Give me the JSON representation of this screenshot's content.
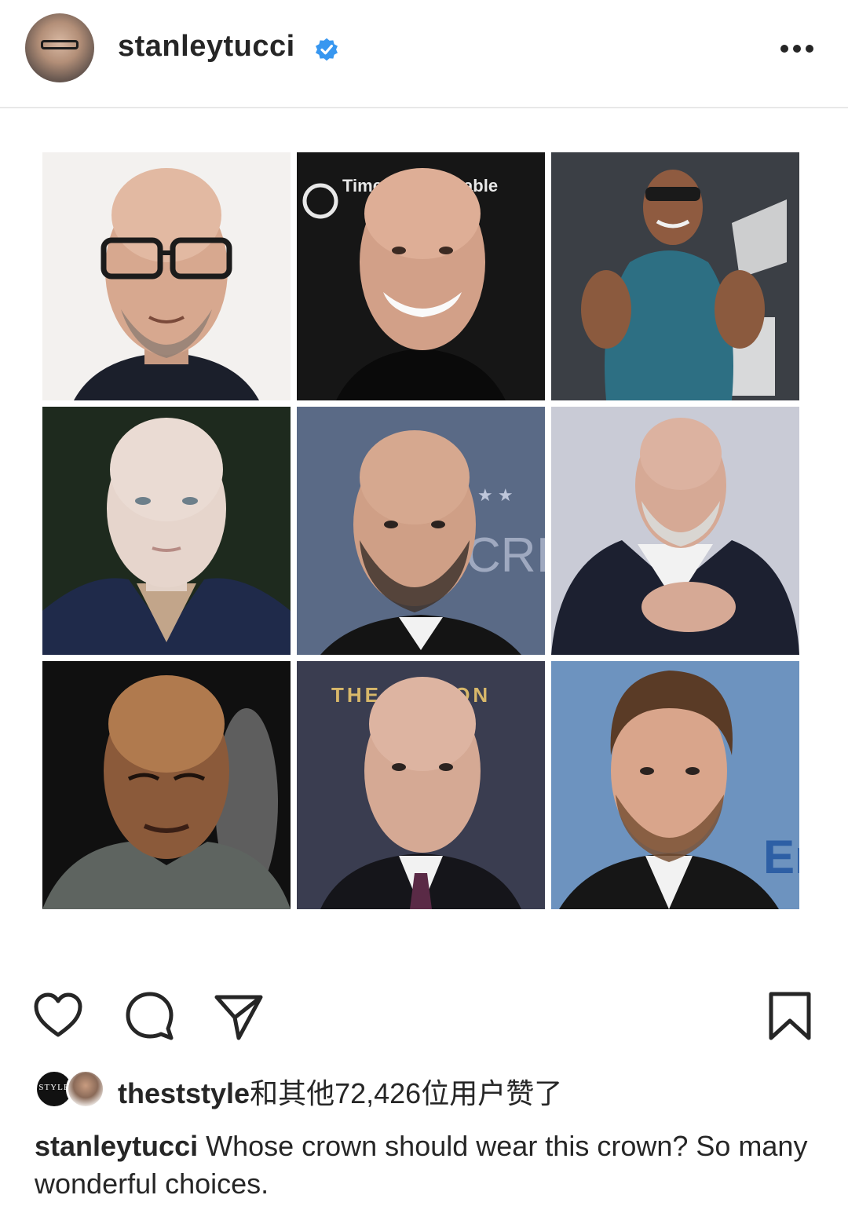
{
  "post": {
    "username": "stanleytucci",
    "verified_icon": "verified-badge-icon",
    "more_icon": "more-horizontal-icon"
  },
  "photo_grid": {
    "tiles": [
      {
        "background": "#f3f1ef"
      },
      {
        "background": "#161616",
        "visible_text": "Time Warner Cable"
      },
      {
        "background": "#3b3f45"
      },
      {
        "background": "#1e2a1e"
      },
      {
        "background": "#5a6a86",
        "visible_text": "CRITICS CHOICE AWARDS"
      },
      {
        "background": "#c9cbd6"
      },
      {
        "background": "#101010"
      },
      {
        "background": "#3a3d50",
        "visible_text": "THE MOTION"
      },
      {
        "background": "#6d93bf",
        "visible_text": "En"
      }
    ]
  },
  "actions": {
    "like_icon": "heart-icon",
    "comment_icon": "comment-icon",
    "share_icon": "send-icon",
    "save_icon": "bookmark-icon"
  },
  "likes": {
    "first_liker": "theststyle",
    "rest": "和其他72,426位用户赞了",
    "avatar1_text": "STYLE"
  },
  "caption": {
    "username": "stanleytucci",
    "text": "Whose crown should wear this crown? So many wonderful choices."
  }
}
